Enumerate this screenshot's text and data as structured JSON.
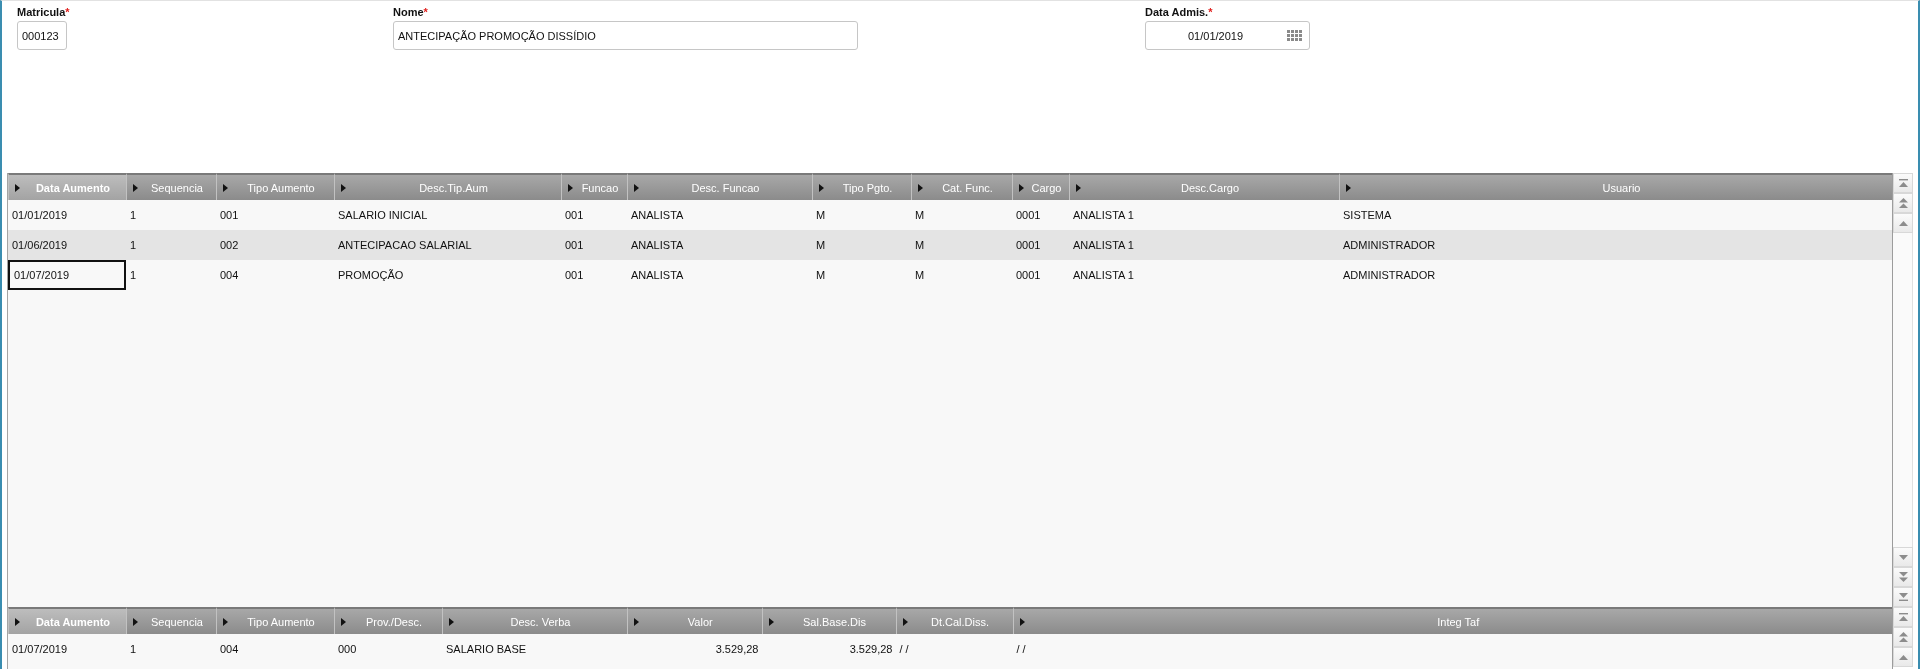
{
  "form": {
    "fields": [
      {
        "kind": "text",
        "label": "Matricula",
        "required_mark": "*",
        "value": "000123"
      },
      {
        "kind": "text",
        "label": "Nome",
        "required_mark": "*",
        "value": "ANTECIPAÇÃO PROMOÇÃO DISSÍDIO"
      },
      {
        "kind": "date",
        "label": "Data Admis.",
        "required_mark": "*",
        "value": "01/01/2019"
      }
    ]
  },
  "tables": [
    {
      "columns": [
        {
          "label": "Data Aumento",
          "kind": "text",
          "sorted": true
        },
        {
          "label": "Sequencia",
          "kind": "text",
          "sorted": false
        },
        {
          "label": "Tipo Aumento",
          "kind": "text",
          "sorted": false
        },
        {
          "label": "Desc.Tip.Aum",
          "kind": "text",
          "sorted": false
        },
        {
          "label": "Funcao",
          "kind": "text",
          "sorted": false
        },
        {
          "label": "Desc. Funcao",
          "kind": "text",
          "sorted": false
        },
        {
          "label": "Tipo Pgto.",
          "kind": "text",
          "sorted": false
        },
        {
          "label": "Cat. Func.",
          "kind": "text",
          "sorted": false
        },
        {
          "label": "Cargo",
          "kind": "text",
          "sorted": false
        },
        {
          "label": "Desc.Cargo",
          "kind": "text",
          "sorted": false
        },
        {
          "label": "Usuario",
          "kind": "text",
          "sorted": false
        }
      ],
      "rows": [
        {
          "selected": false,
          "cells": [
            "01/01/2019",
            "1",
            "001",
            "SALARIO INICIAL",
            "001",
            "ANALISTA",
            "M",
            "M",
            "0001",
            "ANALISTA 1",
            "SISTEMA"
          ]
        },
        {
          "selected": false,
          "cells": [
            "01/06/2019",
            "1",
            "002",
            "ANTECIPACAO SALARIAL",
            "001",
            "ANALISTA",
            "M",
            "M",
            "0001",
            "ANALISTA 1",
            "ADMINISTRADOR"
          ]
        },
        {
          "selected": true,
          "cells": [
            "01/07/2019",
            "1",
            "004",
            "PROMOÇÃO",
            "001",
            "ANALISTA",
            "M",
            "M",
            "0001",
            "ANALISTA 1",
            "ADMINISTRADOR"
          ]
        }
      ]
    },
    {
      "columns": [
        {
          "label": "Data Aumento",
          "kind": "text",
          "sorted": true
        },
        {
          "label": "Sequencia",
          "kind": "text",
          "sorted": false
        },
        {
          "label": "Tipo Aumento",
          "kind": "text",
          "sorted": false
        },
        {
          "label": "Prov./Desc.",
          "kind": "text",
          "sorted": false
        },
        {
          "label": "Desc. Verba",
          "kind": "text",
          "sorted": false
        },
        {
          "label": "Valor",
          "kind": "number",
          "sorted": false
        },
        {
          "label": "Sal.Base.Dis",
          "kind": "number",
          "sorted": false
        },
        {
          "label": "Dt.Cal.Diss.",
          "kind": "text",
          "sorted": false
        },
        {
          "label": "Integ Taf",
          "kind": "text",
          "sorted": false
        }
      ],
      "rows": [
        {
          "selected": false,
          "cells": [
            "01/07/2019",
            "1",
            "004",
            "000",
            "SALARIO BASE",
            "3.529,28",
            "3.529,28",
            "/ /",
            "/ /"
          ]
        }
      ]
    }
  ]
}
